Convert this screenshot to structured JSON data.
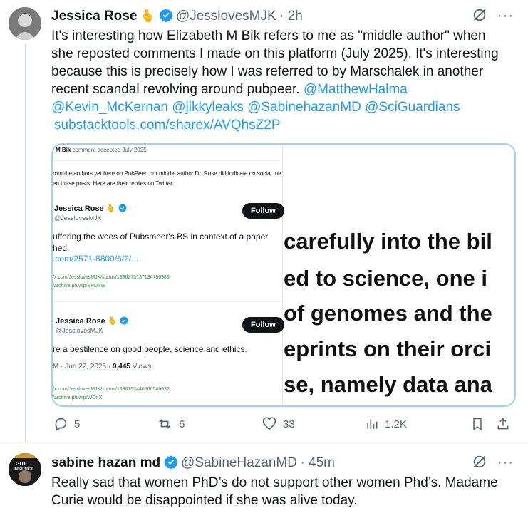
{
  "post1": {
    "name": "Jessica Rose",
    "name_emoji": "🫰",
    "handle": "@JesslovesMJK",
    "time": "2h",
    "text_lines": [
      "It's interesting how Elizabeth M Bik refers to me as \"middle author\" when",
      "she reposted comments I made on this platform (July 2025). It's interesting",
      "because this is precisely how I was referred to by Marschalek in another",
      "recent scandal revolving around pubpeer. "
    ],
    "mention_inline": "@MatthewHalma",
    "mentions_line": "@Kevin_McKernan @jikkyleaks @SabinehazanMD @SciGuardians",
    "url": "substacktools.com/sharex/AVQhsZ2P",
    "media": {
      "header_name": "M Bik",
      "header_meta": "comment accepted July 2025",
      "intro_line1": "rom the authors yet here on PubPeer, but middle author Dr. Rose did indicate on social me",
      "intro_line2": "en these posts. Here are their replies on Twitter:",
      "card1": {
        "name": "Jessica Rose",
        "emoji": "🫰",
        "handle": "@JesslovesMJK",
        "follow": "Follow",
        "text1": "uffering the woes of Pubsmeer's BS in context of a paper",
        "text2": "hed.",
        "link": ".com/2571-8800/6/2/...",
        "src1": "/x.com/JesslovesMJK/status/1936275137134796989",
        "src2": "/archive.ph/wip/BPDTW"
      },
      "card2": {
        "name": "Jessica Rose",
        "emoji": "🫰",
        "handle": "@JesslovesMJK",
        "follow": "Follow",
        "text1": "re a pestilence on good people, science and ethics.",
        "meta": "M · Jun 22, 2025 · ",
        "views_num": "9,445",
        "views_label": " Views",
        "src1": "/x.com/JesslovesMJK/status/1936752440566546632",
        "src2": "/archive.ph/wip/WOrjX"
      },
      "zoom_lines": [
        "carefully into the bil",
        "ed to science, one i",
        "of genomes and the",
        "eprints on their orci",
        "se, namely data ana"
      ]
    },
    "actions": {
      "replies": "5",
      "reposts": "6",
      "likes": "33",
      "views": "1.2K"
    }
  },
  "post2": {
    "name": "sabine hazan md",
    "handle": "@SabineHazanMD",
    "time": "45m",
    "avatar_text1": "GUT",
    "avatar_text2": "INSTINCT",
    "text_lines": [
      "Really sad that women PhD’s do not support other women Phd’s. Madame",
      "Curie would be disappointed if she was alive today."
    ]
  },
  "colors": {
    "accent": "#1d9bf0",
    "muted": "#536471",
    "verified": "#1d9bf0"
  }
}
